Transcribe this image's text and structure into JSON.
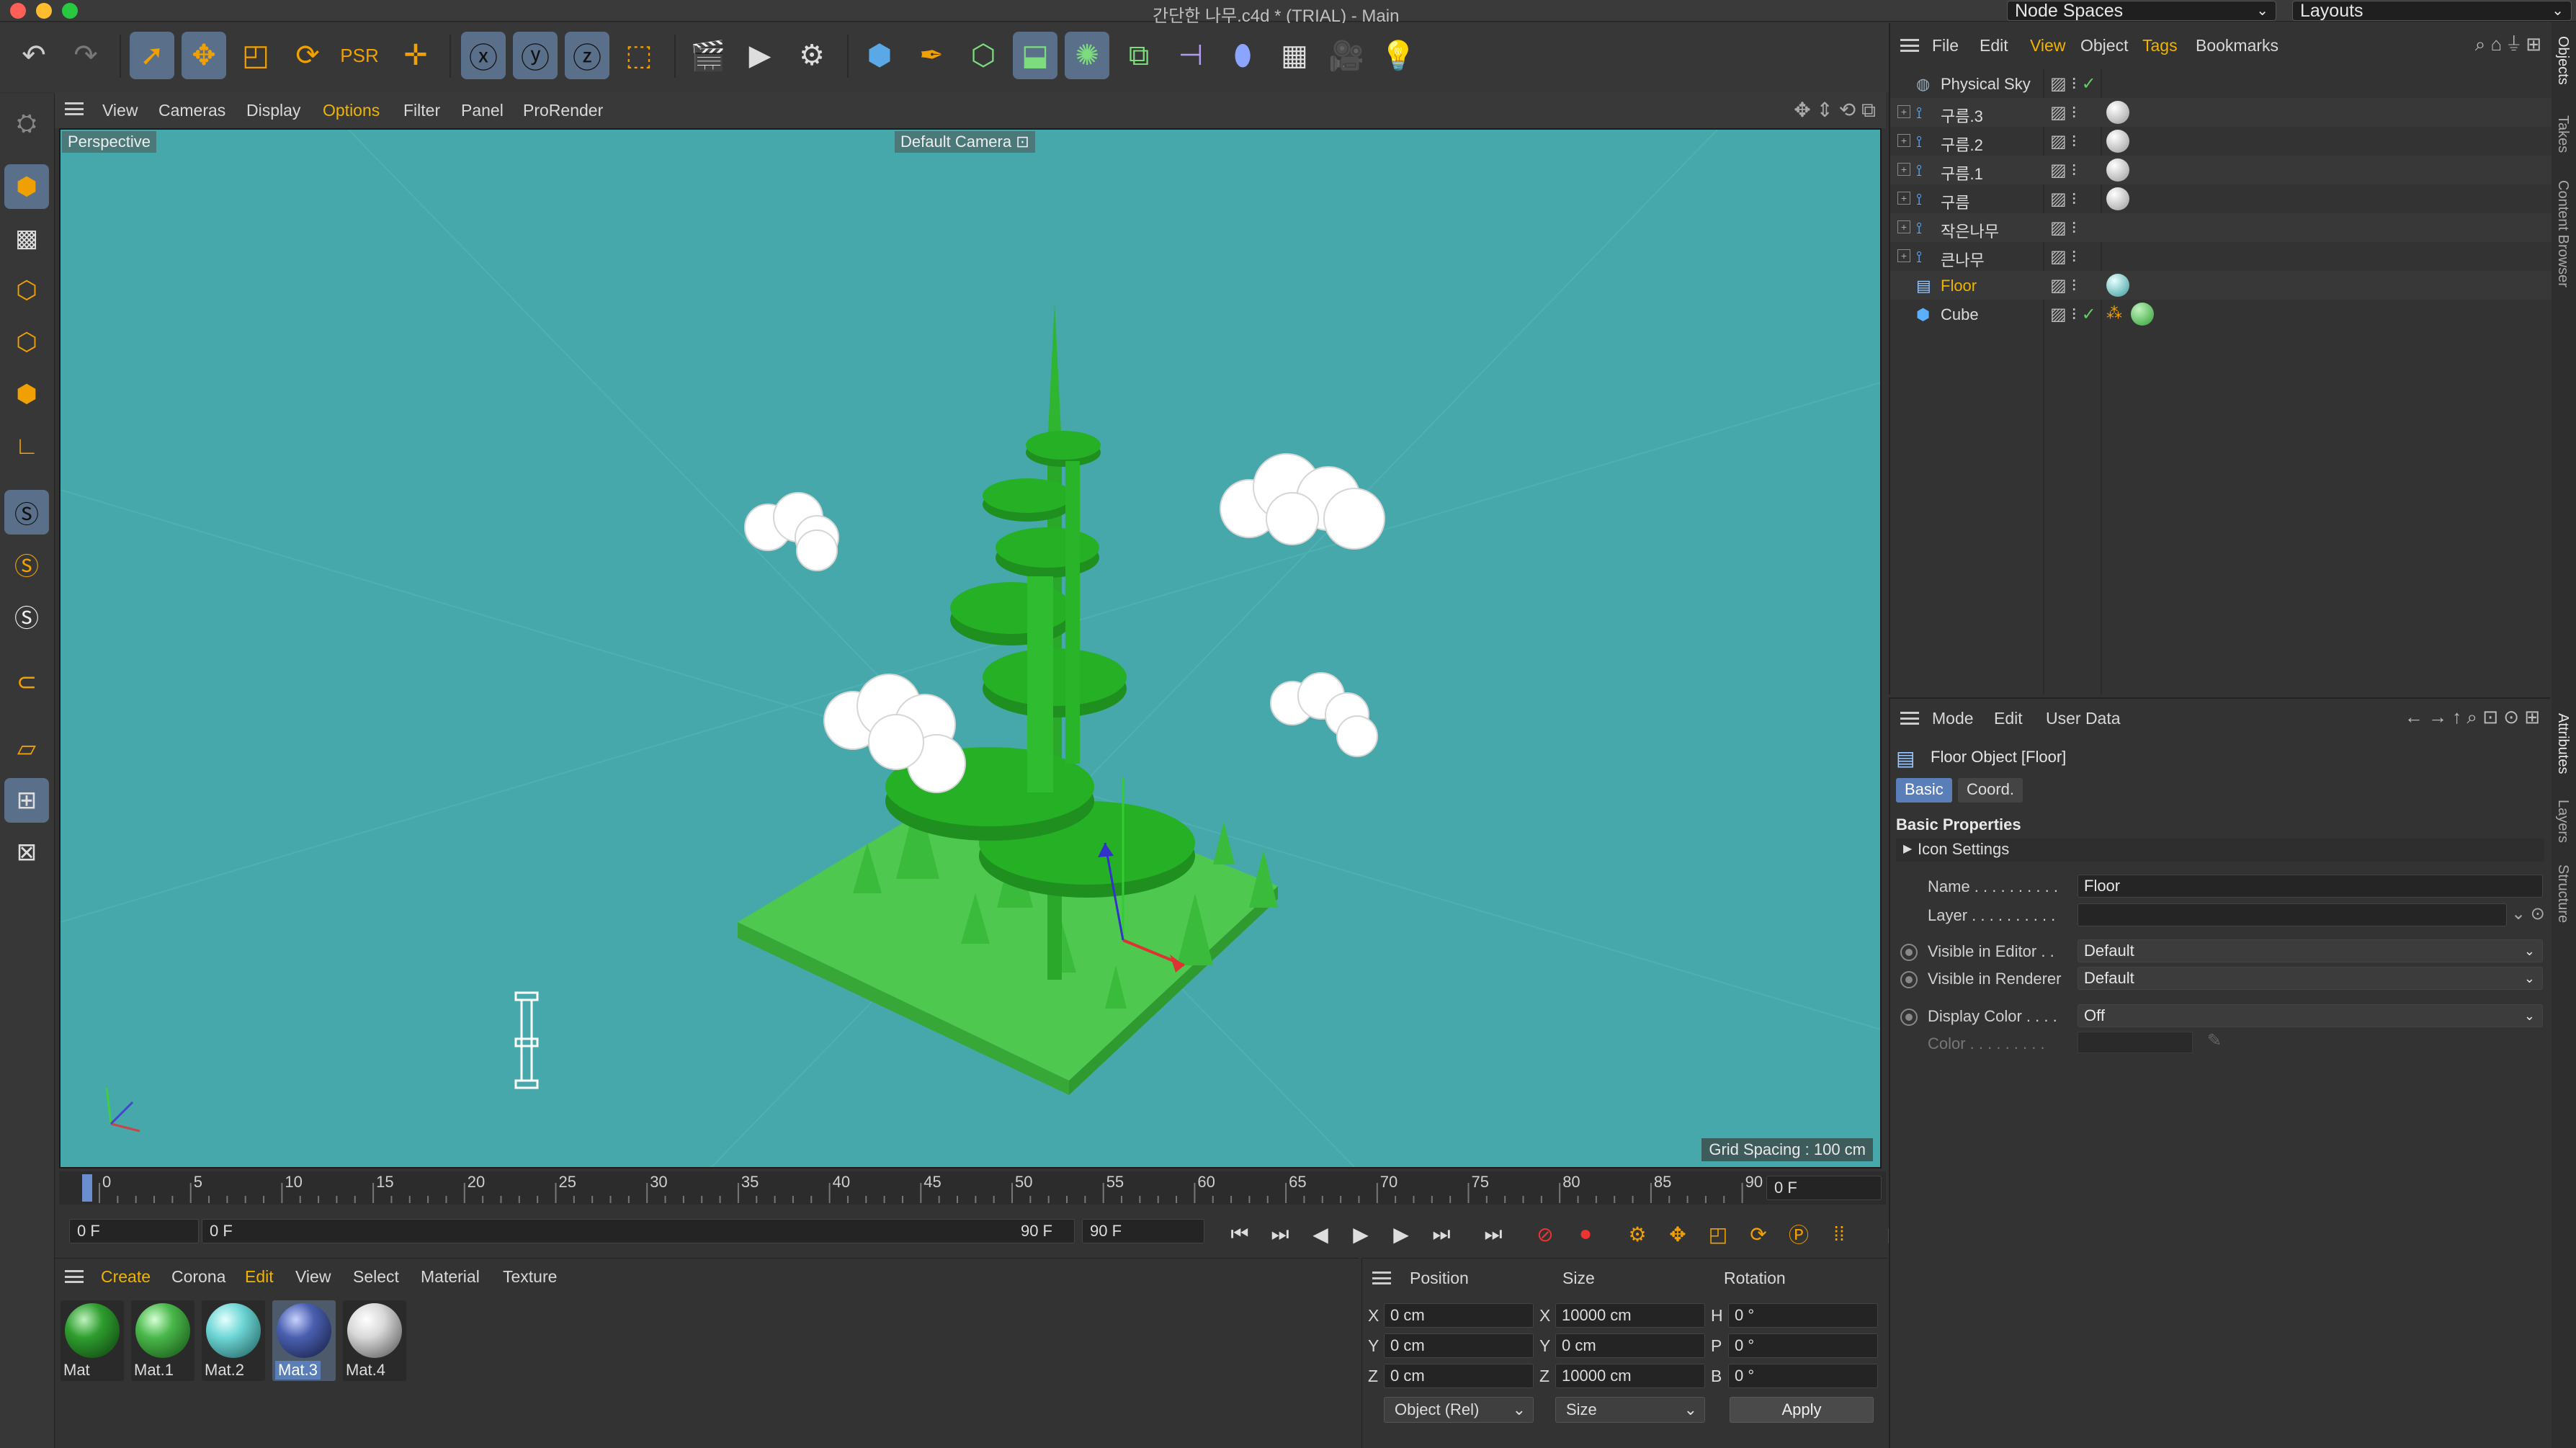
{
  "window": {
    "title": "간단한 나무.c4d * (TRIAL) - Main",
    "node_spaces": "Node Spaces",
    "layouts": "Layouts"
  },
  "viewport_menu": {
    "items": [
      "View",
      "Cameras",
      "Display",
      "Options",
      "Filter",
      "Panel",
      "ProRender"
    ],
    "highlighted": "Options",
    "view_label": "Perspective",
    "camera_label": "Default Camera",
    "grid_spacing": "Grid Spacing : 100 cm"
  },
  "scene_colors": {
    "background": "#46a8ab",
    "floor": "#4cc44c",
    "tree": "#22b022",
    "cloud": "#ffffff"
  },
  "timeline": {
    "ticks": [
      "0",
      "5",
      "10",
      "15",
      "20",
      "25",
      "30",
      "35",
      "40",
      "45",
      "50",
      "55",
      "60",
      "65",
      "70",
      "75",
      "80",
      "85",
      "90"
    ],
    "current_frame": "0 F",
    "start_frame": "0 F",
    "range_start": "0 F",
    "range_end": "90 F",
    "end_frame": "90 F"
  },
  "material_manager": {
    "menu": [
      "Create",
      "Corona",
      "Edit",
      "View",
      "Select",
      "Material",
      "Texture"
    ],
    "highlighted": [
      "Create",
      "Edit"
    ],
    "materials": [
      {
        "name": "Mat",
        "color": "#2f9e2f"
      },
      {
        "name": "Mat.1",
        "color": "#4ab84a"
      },
      {
        "name": "Mat.2",
        "color": "#6fd6d6"
      },
      {
        "name": "Mat.3",
        "color": "#4a5fb0"
      },
      {
        "name": "Mat.4",
        "color": "#d8d8d8"
      }
    ],
    "selected": "Mat.3"
  },
  "coordinates": {
    "headers": {
      "position": "Position",
      "size": "Size",
      "rotation": "Rotation"
    },
    "rows": [
      {
        "axis": "X",
        "pos": "0 cm",
        "size_axis": "X",
        "size": "10000 cm",
        "rot_axis": "H",
        "rot": "0 °"
      },
      {
        "axis": "Y",
        "pos": "0 cm",
        "size_axis": "Y",
        "size": "0 cm",
        "rot_axis": "P",
        "rot": "0 °"
      },
      {
        "axis": "Z",
        "pos": "0 cm",
        "size_axis": "Z",
        "size": "10000 cm",
        "rot_axis": "B",
        "rot": "0 °"
      }
    ],
    "mode": "Object (Rel)",
    "size_mode": "Size",
    "apply": "Apply"
  },
  "objects_manager": {
    "menu": [
      "File",
      "Edit",
      "View",
      "Object",
      "Tags",
      "Bookmarks"
    ],
    "highlighted": [
      "View",
      "Tags"
    ],
    "rows": [
      {
        "name": "Physical Sky",
        "icon": "sky-icon"
      },
      {
        "name": "구름.3",
        "icon": "null-icon"
      },
      {
        "name": "구름.2",
        "icon": "null-icon"
      },
      {
        "name": "구름.1",
        "icon": "null-icon"
      },
      {
        "name": "구름",
        "icon": "null-icon"
      },
      {
        "name": "작은나무",
        "icon": "null-icon"
      },
      {
        "name": "큰나무",
        "icon": "null-icon"
      },
      {
        "name": "Floor",
        "icon": "floor-icon"
      },
      {
        "name": "Cube",
        "icon": "cube-icon"
      }
    ],
    "selected": "Floor"
  },
  "attributes": {
    "menu": [
      "Mode",
      "Edit",
      "User Data"
    ],
    "title": "Floor Object [Floor]",
    "tabs": [
      "Basic",
      "Coord."
    ],
    "active_tab": "Basic",
    "section": "Basic Properties",
    "subsection": "Icon Settings",
    "name_label": "Name . . . . . . . . . .",
    "name_value": "Floor",
    "layer_label": "Layer . . . . . . . . . .",
    "visible_editor_label": "Visible in Editor . .",
    "visible_editor_value": "Default",
    "visible_renderer_label": "Visible in Renderer",
    "visible_renderer_value": "Default",
    "display_color_label": "Display Color . . . .",
    "display_color_value": "Off",
    "color_label": "Color . . . . . . . . ."
  },
  "side_tabs": {
    "top": [
      "Objects",
      "Takes",
      "Content Browser"
    ],
    "bottom": [
      "Attributes",
      "Layers",
      "Structure"
    ]
  }
}
